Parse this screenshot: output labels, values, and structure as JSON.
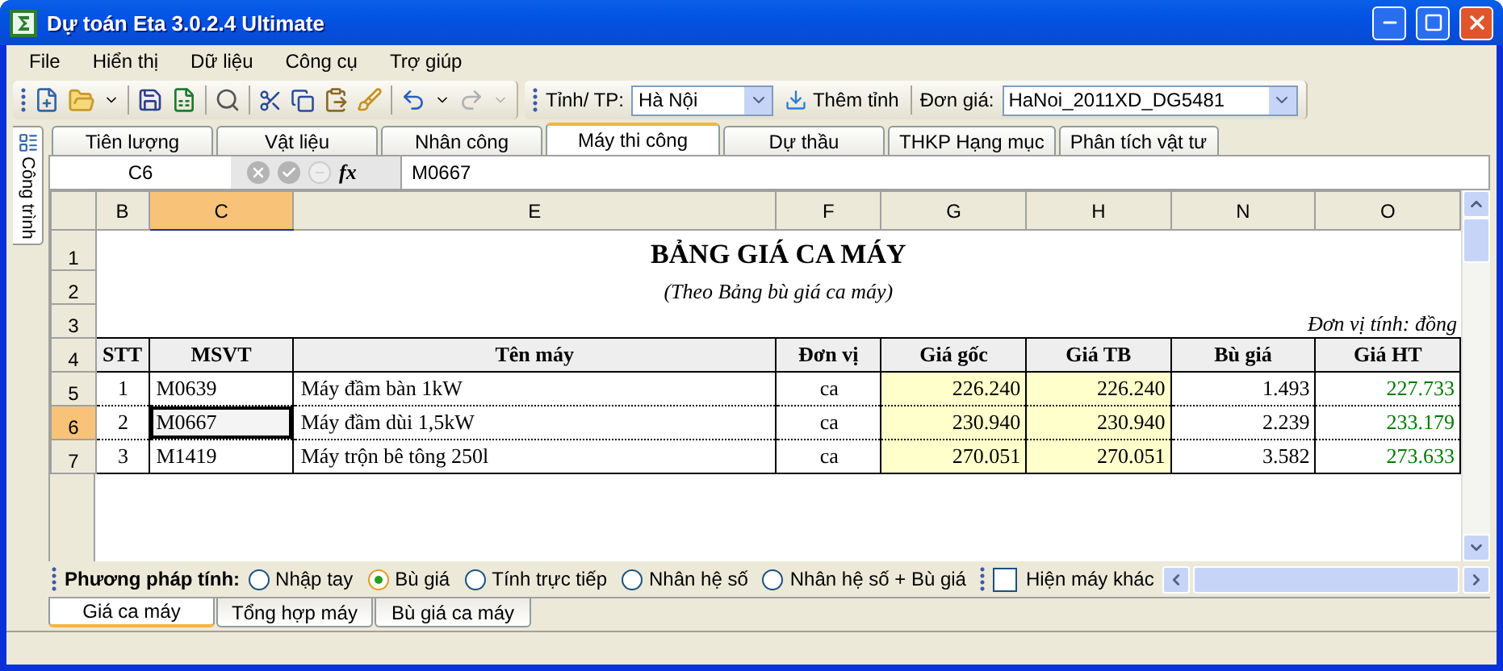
{
  "window": {
    "title": "Dự toán Eta 3.0.2.4 Ultimate"
  },
  "menu": [
    "File",
    "Hiển thị",
    "Dữ liệu",
    "Công cụ",
    "Trợ giúp"
  ],
  "toolbar": {
    "province_label": "Tỉnh/ TP:",
    "province": "Hà Nội",
    "add_button": "Thêm tỉnh",
    "price_label": "Đơn giá:",
    "price": "HaNoi_2011XD_DG5481"
  },
  "side_tab": "Công trình",
  "tabs": [
    {
      "label": "Tiên lượng",
      "selected": false
    },
    {
      "label": "Vật liệu",
      "selected": false
    },
    {
      "label": "Nhân công",
      "selected": false
    },
    {
      "label": "Máy thi công",
      "selected": true
    },
    {
      "label": "Dự thầu",
      "selected": false
    },
    {
      "label": "THKP Hạng mục",
      "selected": false
    },
    {
      "label": "Phân tích vật tư",
      "selected": false
    }
  ],
  "formula_bar": {
    "cell": "C6",
    "fx": "fx",
    "value": "M0667"
  },
  "columns": [
    {
      "label": "B",
      "selected": false
    },
    {
      "label": "C",
      "selected": true
    },
    {
      "label": "E",
      "selected": false
    },
    {
      "label": "F",
      "selected": false
    },
    {
      "label": "G",
      "selected": false
    },
    {
      "label": "H",
      "selected": false
    },
    {
      "label": "N",
      "selected": false
    },
    {
      "label": "O",
      "selected": false
    }
  ],
  "row_numbers": [
    {
      "label": "1",
      "selected": false
    },
    {
      "label": "2",
      "selected": false
    },
    {
      "label": "3",
      "selected": false
    },
    {
      "label": "4",
      "selected": false
    },
    {
      "label": "5",
      "selected": false
    },
    {
      "label": "6",
      "selected": true
    },
    {
      "label": "7",
      "selected": false
    }
  ],
  "sheet": {
    "title": "BẢNG GIÁ CA MÁY",
    "subtitle": "(Theo Bảng bù giá ca máy)",
    "unit": "Đơn vị tính: đồng",
    "headers": [
      "STT",
      "MSVT",
      "Tên máy",
      "Đơn vị",
      "Giá gốc",
      "Giá TB",
      "Bù giá",
      "Giá HT"
    ],
    "rows": [
      {
        "stt": "1",
        "msvt": "M0639",
        "name": "Máy đầm bàn 1kW",
        "unit": "ca",
        "base_price": "226.240",
        "avg_price": "226.240",
        "compensation": "1.493",
        "current_price": "227.733",
        "selected": false
      },
      {
        "stt": "2",
        "msvt": "M0667",
        "name": "Máy đầm dùi 1,5kW",
        "unit": "ca",
        "base_price": "230.940",
        "avg_price": "230.940",
        "compensation": "2.239",
        "current_price": "233.179",
        "selected": true
      },
      {
        "stt": "3",
        "msvt": "M1419",
        "name": "Máy trộn bê tông 250l",
        "unit": "ca",
        "base_price": "270.051",
        "avg_price": "270.051",
        "compensation": "3.582",
        "current_price": "273.633",
        "selected": false
      }
    ]
  },
  "method": {
    "label": "Phương pháp tính:",
    "options": [
      {
        "label": "Nhập tay",
        "selected": false
      },
      {
        "label": "Bù giá",
        "selected": true
      },
      {
        "label": "Tính trực tiếp",
        "selected": false
      },
      {
        "label": "Nhân hệ số",
        "selected": false
      },
      {
        "label": "Nhân hệ số + Bù giá",
        "selected": false
      }
    ]
  },
  "show_other": {
    "label": "Hiện máy khác",
    "checked": false
  },
  "sheet_tabs": [
    {
      "label": "Giá ca máy",
      "selected": true
    },
    {
      "label": "Tổng hợp máy",
      "selected": false
    },
    {
      "label": "Bù giá ca máy",
      "selected": false
    }
  ]
}
